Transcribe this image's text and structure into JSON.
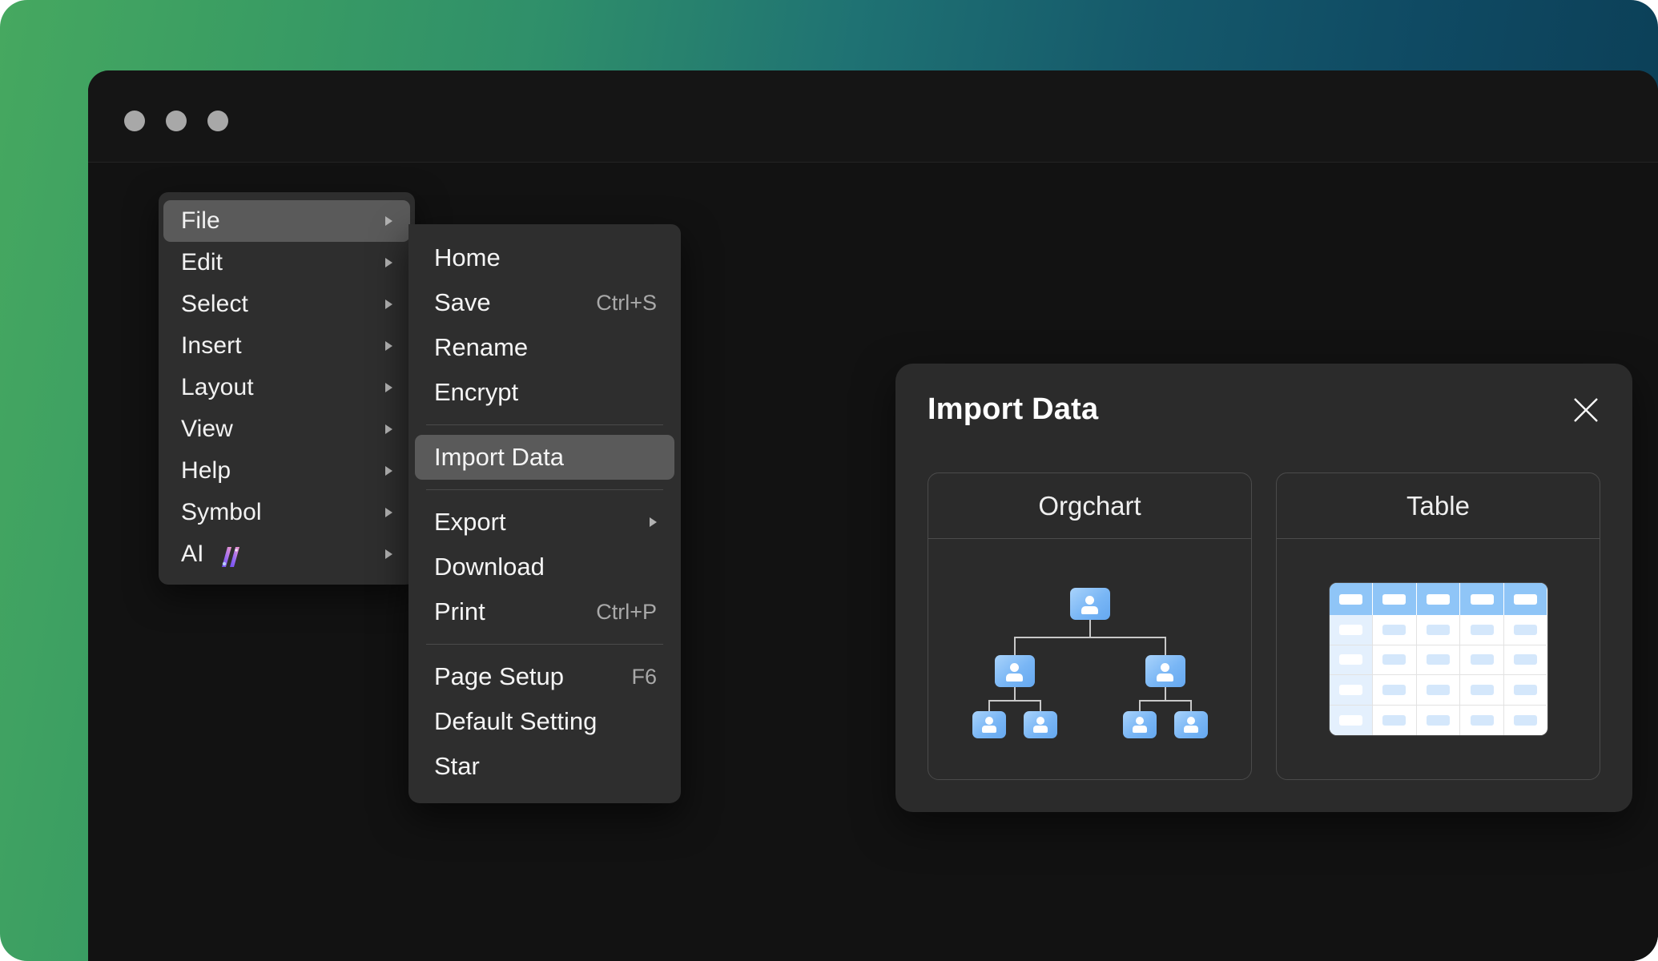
{
  "window": {
    "traffic_lights": [
      "close-dot",
      "minimize-dot",
      "maximize-dot"
    ]
  },
  "theme": {
    "backdrop_from": "#46a860",
    "backdrop_to": "#0b3c53",
    "window_bg": "#131313",
    "menu_bg": "#2e2e2e",
    "menu_highlight": "#5a5a5a",
    "dialog_bg": "#2b2b2b",
    "accent_blue": "#79b6f5",
    "text_primary": "#f4f4f4",
    "text_muted": "#a9a9a9"
  },
  "menu_primary": {
    "items": [
      {
        "label": "File",
        "has_submenu": true,
        "active": true,
        "badge": null
      },
      {
        "label": "Edit",
        "has_submenu": true,
        "active": false,
        "badge": null
      },
      {
        "label": "Select",
        "has_submenu": true,
        "active": false,
        "badge": null
      },
      {
        "label": "Insert",
        "has_submenu": true,
        "active": false,
        "badge": null
      },
      {
        "label": "Layout",
        "has_submenu": true,
        "active": false,
        "badge": null
      },
      {
        "label": "View",
        "has_submenu": true,
        "active": false,
        "badge": null
      },
      {
        "label": "Help",
        "has_submenu": true,
        "active": false,
        "badge": null
      },
      {
        "label": "Symbol",
        "has_submenu": true,
        "active": false,
        "badge": null
      },
      {
        "label": "AI",
        "has_submenu": true,
        "active": false,
        "badge": "ai-sparkle-icon"
      }
    ]
  },
  "menu_file": {
    "items": [
      {
        "label": "Home",
        "shortcut": "",
        "has_submenu": false,
        "active": false,
        "separator_after": false
      },
      {
        "label": "Save",
        "shortcut": "Ctrl+S",
        "has_submenu": false,
        "active": false,
        "separator_after": false
      },
      {
        "label": "Rename",
        "shortcut": "",
        "has_submenu": false,
        "active": false,
        "separator_after": false
      },
      {
        "label": "Encrypt",
        "shortcut": "",
        "has_submenu": false,
        "active": false,
        "separator_after": true
      },
      {
        "label": "Import Data",
        "shortcut": "",
        "has_submenu": false,
        "active": true,
        "separator_after": true
      },
      {
        "label": "Export",
        "shortcut": "",
        "has_submenu": true,
        "active": false,
        "separator_after": false
      },
      {
        "label": "Download",
        "shortcut": "",
        "has_submenu": false,
        "active": false,
        "separator_after": false
      },
      {
        "label": "Print",
        "shortcut": "Ctrl+P",
        "has_submenu": false,
        "active": false,
        "separator_after": true
      },
      {
        "label": "Page Setup",
        "shortcut": "F6",
        "has_submenu": false,
        "active": false,
        "separator_after": false
      },
      {
        "label": "Default Setting",
        "shortcut": "",
        "has_submenu": false,
        "active": false,
        "separator_after": false
      },
      {
        "label": "Star",
        "shortcut": "",
        "has_submenu": false,
        "active": false,
        "separator_after": false
      }
    ]
  },
  "dialog": {
    "title": "Import Data",
    "close_icon": "close-icon",
    "cards": [
      {
        "title": "Orgchart",
        "illustration": "orgchart-illustration"
      },
      {
        "title": "Table",
        "illustration": "table-illustration"
      }
    ]
  },
  "orgchart_illustration": {
    "levels": [
      1,
      2,
      4
    ],
    "node_icon": "person-icon",
    "connector_color": "#c8c8c8",
    "node_color": "#79b6f5"
  },
  "table_illustration": {
    "columns": 5,
    "rows": 5,
    "header_row": 1,
    "header_color": "#8fc5f7",
    "first_column_color": "#e4f0fd",
    "cell_color": "#ffffff"
  }
}
